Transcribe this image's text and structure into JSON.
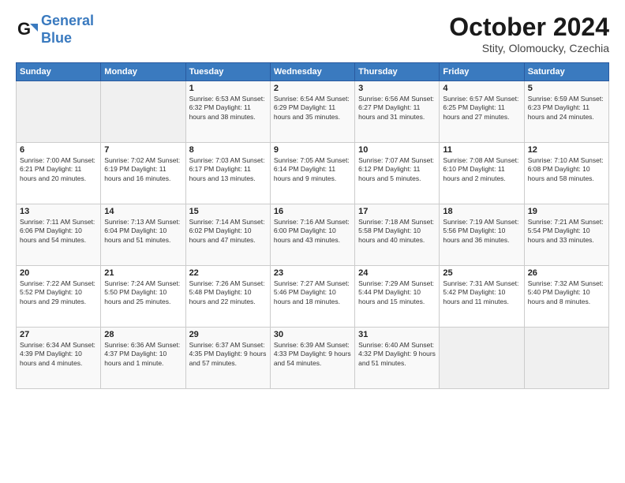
{
  "logo": {
    "line1": "General",
    "line2": "Blue"
  },
  "title": "October 2024",
  "subtitle": "Stity, Olomoucky, Czechia",
  "days_header": [
    "Sunday",
    "Monday",
    "Tuesday",
    "Wednesday",
    "Thursday",
    "Friday",
    "Saturday"
  ],
  "weeks": [
    [
      {
        "day": "",
        "content": ""
      },
      {
        "day": "",
        "content": ""
      },
      {
        "day": "1",
        "content": "Sunrise: 6:53 AM\nSunset: 6:32 PM\nDaylight: 11 hours and 38 minutes."
      },
      {
        "day": "2",
        "content": "Sunrise: 6:54 AM\nSunset: 6:29 PM\nDaylight: 11 hours and 35 minutes."
      },
      {
        "day": "3",
        "content": "Sunrise: 6:56 AM\nSunset: 6:27 PM\nDaylight: 11 hours and 31 minutes."
      },
      {
        "day": "4",
        "content": "Sunrise: 6:57 AM\nSunset: 6:25 PM\nDaylight: 11 hours and 27 minutes."
      },
      {
        "day": "5",
        "content": "Sunrise: 6:59 AM\nSunset: 6:23 PM\nDaylight: 11 hours and 24 minutes."
      }
    ],
    [
      {
        "day": "6",
        "content": "Sunrise: 7:00 AM\nSunset: 6:21 PM\nDaylight: 11 hours and 20 minutes."
      },
      {
        "day": "7",
        "content": "Sunrise: 7:02 AM\nSunset: 6:19 PM\nDaylight: 11 hours and 16 minutes."
      },
      {
        "day": "8",
        "content": "Sunrise: 7:03 AM\nSunset: 6:17 PM\nDaylight: 11 hours and 13 minutes."
      },
      {
        "day": "9",
        "content": "Sunrise: 7:05 AM\nSunset: 6:14 PM\nDaylight: 11 hours and 9 minutes."
      },
      {
        "day": "10",
        "content": "Sunrise: 7:07 AM\nSunset: 6:12 PM\nDaylight: 11 hours and 5 minutes."
      },
      {
        "day": "11",
        "content": "Sunrise: 7:08 AM\nSunset: 6:10 PM\nDaylight: 11 hours and 2 minutes."
      },
      {
        "day": "12",
        "content": "Sunrise: 7:10 AM\nSunset: 6:08 PM\nDaylight: 10 hours and 58 minutes."
      }
    ],
    [
      {
        "day": "13",
        "content": "Sunrise: 7:11 AM\nSunset: 6:06 PM\nDaylight: 10 hours and 54 minutes."
      },
      {
        "day": "14",
        "content": "Sunrise: 7:13 AM\nSunset: 6:04 PM\nDaylight: 10 hours and 51 minutes."
      },
      {
        "day": "15",
        "content": "Sunrise: 7:14 AM\nSunset: 6:02 PM\nDaylight: 10 hours and 47 minutes."
      },
      {
        "day": "16",
        "content": "Sunrise: 7:16 AM\nSunset: 6:00 PM\nDaylight: 10 hours and 43 minutes."
      },
      {
        "day": "17",
        "content": "Sunrise: 7:18 AM\nSunset: 5:58 PM\nDaylight: 10 hours and 40 minutes."
      },
      {
        "day": "18",
        "content": "Sunrise: 7:19 AM\nSunset: 5:56 PM\nDaylight: 10 hours and 36 minutes."
      },
      {
        "day": "19",
        "content": "Sunrise: 7:21 AM\nSunset: 5:54 PM\nDaylight: 10 hours and 33 minutes."
      }
    ],
    [
      {
        "day": "20",
        "content": "Sunrise: 7:22 AM\nSunset: 5:52 PM\nDaylight: 10 hours and 29 minutes."
      },
      {
        "day": "21",
        "content": "Sunrise: 7:24 AM\nSunset: 5:50 PM\nDaylight: 10 hours and 25 minutes."
      },
      {
        "day": "22",
        "content": "Sunrise: 7:26 AM\nSunset: 5:48 PM\nDaylight: 10 hours and 22 minutes."
      },
      {
        "day": "23",
        "content": "Sunrise: 7:27 AM\nSunset: 5:46 PM\nDaylight: 10 hours and 18 minutes."
      },
      {
        "day": "24",
        "content": "Sunrise: 7:29 AM\nSunset: 5:44 PM\nDaylight: 10 hours and 15 minutes."
      },
      {
        "day": "25",
        "content": "Sunrise: 7:31 AM\nSunset: 5:42 PM\nDaylight: 10 hours and 11 minutes."
      },
      {
        "day": "26",
        "content": "Sunrise: 7:32 AM\nSunset: 5:40 PM\nDaylight: 10 hours and 8 minutes."
      }
    ],
    [
      {
        "day": "27",
        "content": "Sunrise: 6:34 AM\nSunset: 4:39 PM\nDaylight: 10 hours and 4 minutes."
      },
      {
        "day": "28",
        "content": "Sunrise: 6:36 AM\nSunset: 4:37 PM\nDaylight: 10 hours and 1 minute."
      },
      {
        "day": "29",
        "content": "Sunrise: 6:37 AM\nSunset: 4:35 PM\nDaylight: 9 hours and 57 minutes."
      },
      {
        "day": "30",
        "content": "Sunrise: 6:39 AM\nSunset: 4:33 PM\nDaylight: 9 hours and 54 minutes."
      },
      {
        "day": "31",
        "content": "Sunrise: 6:40 AM\nSunset: 4:32 PM\nDaylight: 9 hours and 51 minutes."
      },
      {
        "day": "",
        "content": ""
      },
      {
        "day": "",
        "content": ""
      }
    ]
  ]
}
